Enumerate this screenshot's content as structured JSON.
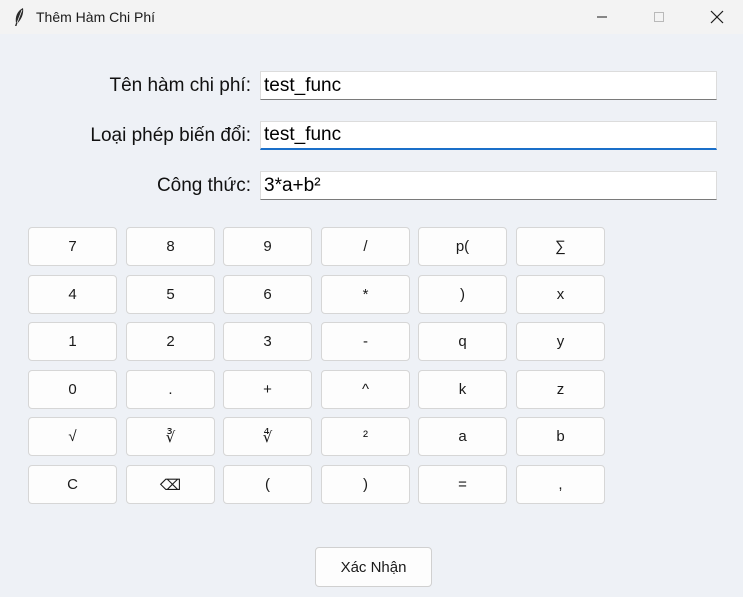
{
  "window": {
    "title": "Thêm Hàm Chi Phí",
    "icon": "feather-icon",
    "controls": [
      "minimize-icon",
      "maximize-icon",
      "close-icon"
    ]
  },
  "form": {
    "name_label": "Tên hàm chi phí:",
    "name_value": "test_func",
    "transform_label": "Loại phép biến đổi:",
    "transform_value": "test_func",
    "formula_label": "Công thức:",
    "formula_value": "3*a+b²"
  },
  "keypad": {
    "rows": [
      [
        "7",
        "8",
        "9",
        "/",
        "p(",
        "∑"
      ],
      [
        "4",
        "5",
        "6",
        "*",
        ")",
        "x"
      ],
      [
        "1",
        "2",
        "3",
        "-",
        "q",
        "y"
      ],
      [
        "0",
        ".",
        "+",
        "^",
        "k",
        "z"
      ],
      [
        "√",
        "∛",
        "∜",
        "²",
        "a",
        "b"
      ],
      [
        "C",
        "⌫",
        "(",
        ")",
        "=",
        ","
      ]
    ]
  },
  "confirm_label": "Xác Nhận",
  "colors": {
    "background": "#eef1f6",
    "focus_accent": "#1a6fc9"
  }
}
